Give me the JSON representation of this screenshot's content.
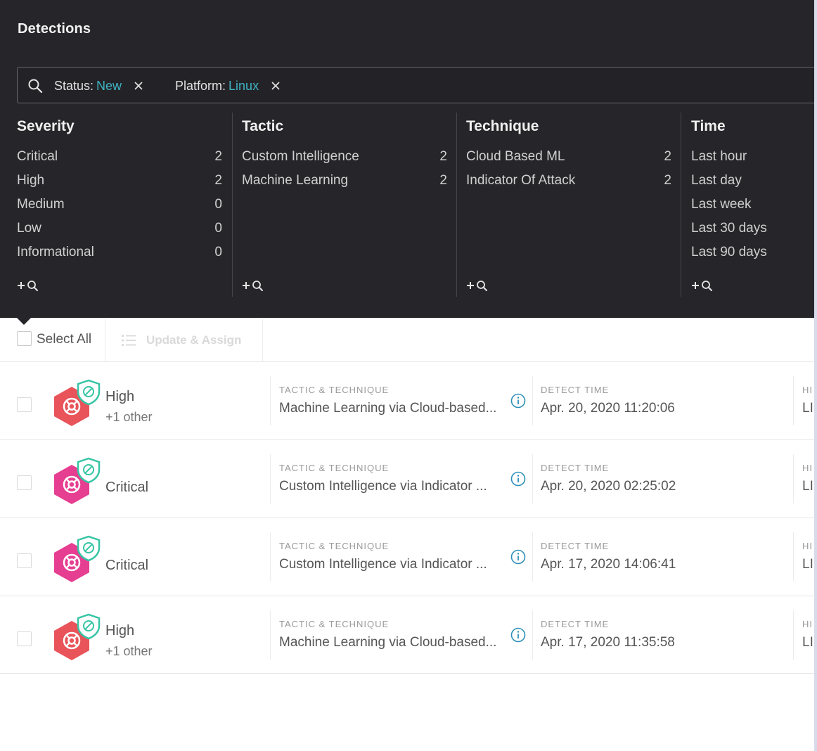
{
  "header": {
    "title": "Detections",
    "filters": [
      {
        "key": "Status:",
        "value": "New"
      },
      {
        "key": "Platform:",
        "value": "Linux"
      }
    ]
  },
  "facets": [
    {
      "title": "Severity",
      "items": [
        {
          "label": "Critical",
          "count": "2"
        },
        {
          "label": "High",
          "count": "2"
        },
        {
          "label": "Medium",
          "count": "0"
        },
        {
          "label": "Low",
          "count": "0"
        },
        {
          "label": "Informational",
          "count": "0"
        }
      ]
    },
    {
      "title": "Tactic",
      "items": [
        {
          "label": "Custom Intelligence",
          "count": "2"
        },
        {
          "label": "Machine Learning",
          "count": "2"
        }
      ]
    },
    {
      "title": "Technique",
      "items": [
        {
          "label": "Cloud Based ML",
          "count": "2"
        },
        {
          "label": "Indicator Of Attack",
          "count": "2"
        }
      ]
    },
    {
      "title": "Time",
      "items": [
        {
          "label": "Last hour"
        },
        {
          "label": "Last day"
        },
        {
          "label": "Last week"
        },
        {
          "label": "Last 30 days"
        },
        {
          "label": "Last 90 days"
        }
      ]
    }
  ],
  "toolbar": {
    "select_all_label": "Select All",
    "update_assign_label": "Update & Assign"
  },
  "detections": {
    "tactic_header": "TACTIC & TECHNIQUE",
    "time_header": "DETECT TIME",
    "host_header_partial": "HI",
    "host_value_partial": "LI",
    "rows": [
      {
        "severity": "High",
        "sub": "+1 other",
        "tactic": "Machine Learning via Cloud-based...",
        "time": "Apr. 20, 2020 11:20:06",
        "color": "#e8545a"
      },
      {
        "severity": "Critical",
        "sub": "",
        "tactic": "Custom Intelligence via Indicator ...",
        "time": "Apr. 20, 2020 02:25:02",
        "color": "#e63e91"
      },
      {
        "severity": "Critical",
        "sub": "",
        "tactic": "Custom Intelligence via Indicator ...",
        "time": "Apr. 17, 2020 14:06:41",
        "color": "#e63e91"
      },
      {
        "severity": "High",
        "sub": "+1 other",
        "tactic": "Machine Learning via Cloud-based...",
        "time": "Apr. 17, 2020 11:35:58",
        "color": "#e8545a"
      }
    ]
  },
  "colors": {
    "panel_bg": "#26262a",
    "filter_value": "#3fb2c2",
    "high": "#e8545a",
    "critical": "#e63e91",
    "shield": "#37c5a4"
  }
}
